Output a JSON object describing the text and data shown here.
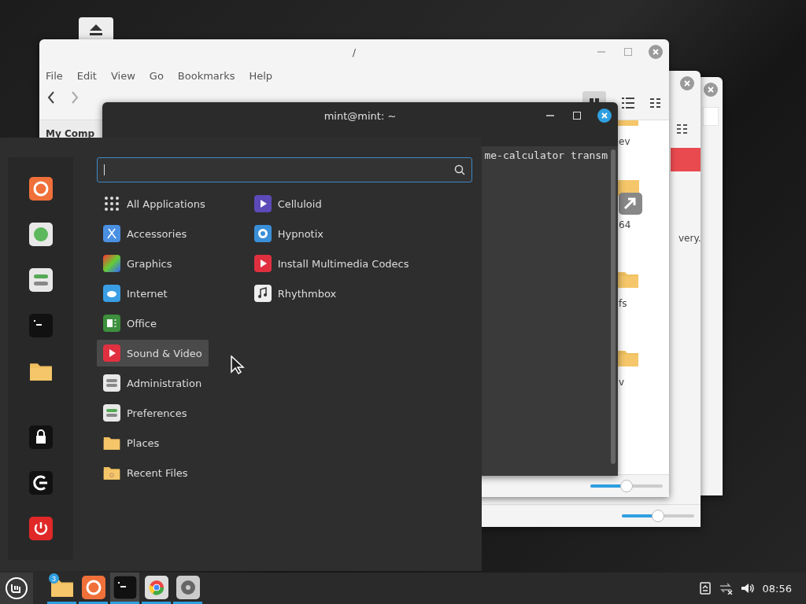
{
  "desktop": {
    "back_window": {
      "text": "very.",
      "zoom": {
        "level": 0.5
      }
    },
    "file_manager": {
      "title": "/",
      "menu": [
        "File",
        "Edit",
        "View",
        "Go",
        "Bookmarks",
        "Help"
      ],
      "sidebar_heading": "My Comp",
      "items": [
        {
          "label": "ev",
          "kind": "folder"
        },
        {
          "label": "64",
          "kind": "link"
        },
        {
          "label": "fs",
          "kind": "folder"
        },
        {
          "label": "v",
          "kind": "folder"
        }
      ],
      "zoom": {
        "level": 0.5
      }
    },
    "terminal": {
      "title": "mint@mint: ~",
      "output": "me-calculator transm"
    }
  },
  "menu": {
    "search": {
      "focused": true
    },
    "categories": [
      {
        "label": "All Applications",
        "selected": false
      },
      {
        "label": "Accessories",
        "selected": false
      },
      {
        "label": "Graphics",
        "selected": false
      },
      {
        "label": "Internet",
        "selected": false
      },
      {
        "label": "Office",
        "selected": false
      },
      {
        "label": "Sound & Video",
        "selected": true
      },
      {
        "label": "Administration",
        "selected": false
      },
      {
        "label": "Preferences",
        "selected": false
      },
      {
        "label": "Places",
        "selected": false
      },
      {
        "label": "Recent Files",
        "selected": false
      }
    ],
    "apps": [
      "Celluloid",
      "Hypnotix",
      "Install Multimedia Codecs",
      "Rhythmbox"
    ]
  },
  "taskbar": {
    "launchers": [
      {
        "badge": "3",
        "selected": false
      },
      {
        "selected": false
      },
      {
        "selected": true
      },
      {
        "selected": false
      },
      {
        "selected": false
      }
    ],
    "clock": "08:56"
  }
}
